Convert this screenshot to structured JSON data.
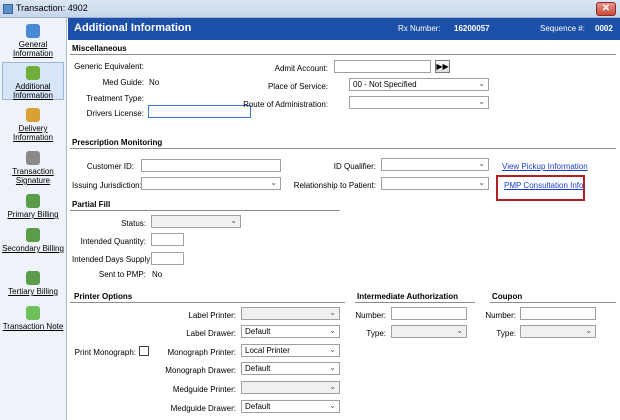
{
  "window": {
    "title": "Transaction: 4902",
    "close_label": "✕"
  },
  "sidebar": {
    "items": [
      {
        "label": "General Information",
        "icon": "general-information-icon",
        "color": "#4a8ad4"
      },
      {
        "label": "Additional Information",
        "icon": "additional-information-icon",
        "color": "#6fae3b"
      },
      {
        "label": "Delivery Information",
        "icon": "delivery-information-icon",
        "color": "#d9a033"
      },
      {
        "label": "Transaction Signature",
        "icon": "transaction-signature-icon",
        "color": "#8a8a8a"
      },
      {
        "label": "Primary Billing",
        "icon": "primary-billing-icon",
        "color": "#5a9c4a"
      },
      {
        "label": "Secondary Billing",
        "icon": "secondary-billing-icon",
        "color": "#5a9c4a"
      },
      {
        "label": "Tertiary Billing",
        "icon": "tertiary-billing-icon",
        "color": "#5a9c4a"
      },
      {
        "label": "Transaction Note",
        "icon": "transaction-note-icon",
        "color": "#6fbf5a"
      }
    ]
  },
  "header": {
    "title": "Additional Information",
    "rx_label": "Rx Number:",
    "rx_value": "16200057",
    "seq_label": "Sequence #:",
    "seq_value": "0002"
  },
  "misc": {
    "section": "Miscellaneous",
    "generic_label": "Generic Equivalent:",
    "medguide_label": "Med Guide:",
    "medguide_value": "No",
    "treatment_label": "Treatment Type:",
    "drivers_label": "Drivers License:",
    "admit_label": "Admit Account:",
    "admit_button": "▶▶",
    "place_label": "Place of Service:",
    "place_value": "00 - Not Specified",
    "route_label": "Route of Administration:"
  },
  "pm": {
    "section": "Prescription Monitoring",
    "customer_label": "Customer ID:",
    "issuing_label": "Issuing Jurisdiction:",
    "idq_label": "ID Qualifier:",
    "rel_label": "Relationship to Patient:",
    "view_pickup": "View Pickup Information",
    "pmp_info": "PMP Consultation Info"
  },
  "partial": {
    "section": "Partial Fill",
    "status_label": "Status:",
    "qty_label": "Intended Quantity:",
    "days_label": "Intended Days Supply:",
    "sent_label": "Sent to PMP:",
    "sent_value": "No"
  },
  "printer": {
    "section": "Printer Options",
    "print_mono_label": "Print Monograph:",
    "label_printer": "Label Printer:",
    "label_drawer": "Label Drawer:",
    "label_drawer_value": "Default",
    "mono_printer": "Monograph Printer:",
    "mono_printer_value": "Local Printer",
    "mono_drawer": "Monograph Drawer:",
    "mono_drawer_value": "Default",
    "medguide_printer": "Medguide Printer:",
    "medguide_drawer": "Medguide Drawer:",
    "medguide_drawer_value": "Default"
  },
  "auth": {
    "section": "Intermediate Authorization",
    "number_label": "Number:",
    "type_label": "Type:"
  },
  "coupon": {
    "section": "Coupon",
    "number_label": "Number:",
    "type_label": "Type:"
  }
}
